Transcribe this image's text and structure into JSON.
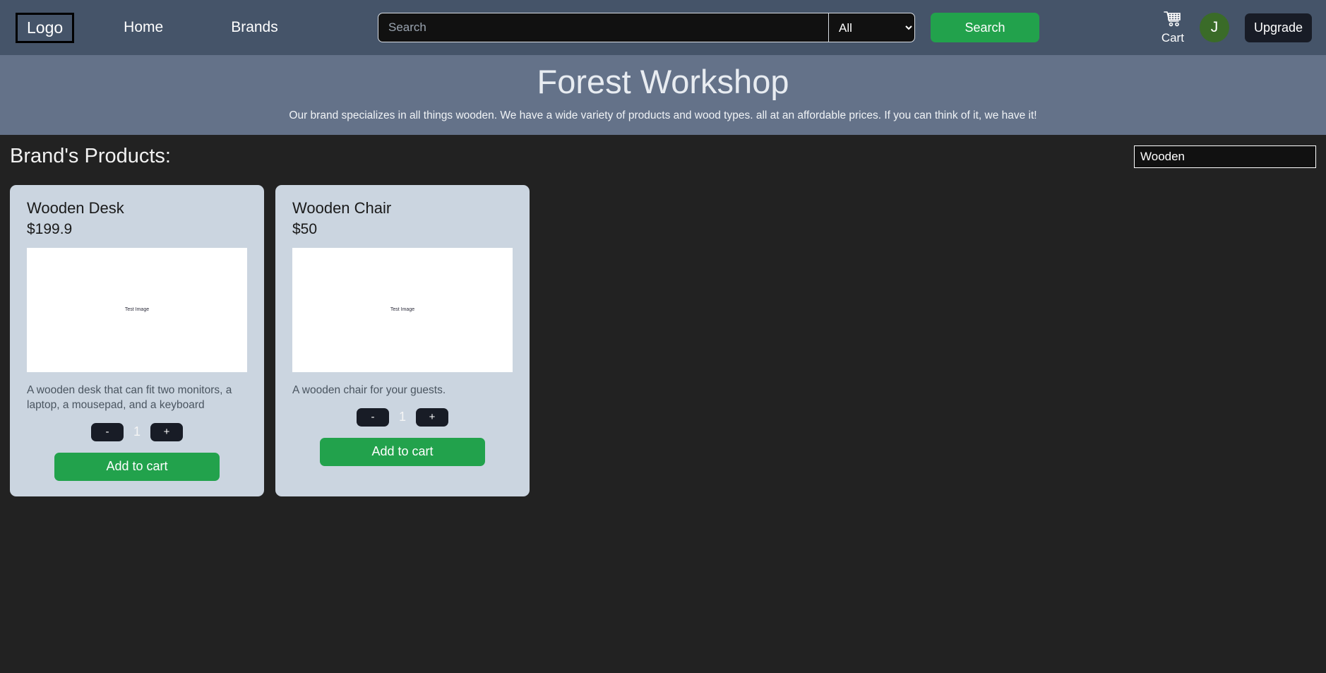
{
  "navbar": {
    "logo": "Logo",
    "links": [
      {
        "label": "Home"
      },
      {
        "label": "Brands"
      }
    ],
    "search": {
      "placeholder": "Search",
      "value": "",
      "category_selected": "All",
      "category_options": [
        "All"
      ],
      "button_label": "Search"
    },
    "cart_label": "Cart",
    "avatar_initial": "J",
    "upgrade_label": "Upgrade",
    "colors": {
      "background": "#455469",
      "accent_green": "#22a24c",
      "avatar_green": "#3a6b28",
      "dark": "#181c26"
    }
  },
  "hero": {
    "title": "Forest Workshop",
    "subtitle": "Our brand specializes in all things wooden. We have a wide variety of products and wood types. all at an affordable prices. If you can think of it, we have it!",
    "background": "#647289"
  },
  "main": {
    "section_title": "Brand's Products:",
    "filter": {
      "value": "Wooden",
      "placeholder": ""
    },
    "products": [
      {
        "title": "Wooden Desk",
        "price": "$199.9",
        "image_alt": "Test Image",
        "description": "A wooden desk that can fit two monitors, a laptop, a mousepad, and a keyboard",
        "decrement_label": "-",
        "quantity": "1",
        "increment_label": "+",
        "add_to_cart_label": "Add to cart"
      },
      {
        "title": "Wooden Chair",
        "price": "$50",
        "image_alt": "Test Image",
        "description": "A wooden chair for your guests.",
        "decrement_label": "-",
        "quantity": "1",
        "increment_label": "+",
        "add_to_cart_label": "Add to cart"
      }
    ]
  },
  "page": {
    "background": "#222222"
  }
}
